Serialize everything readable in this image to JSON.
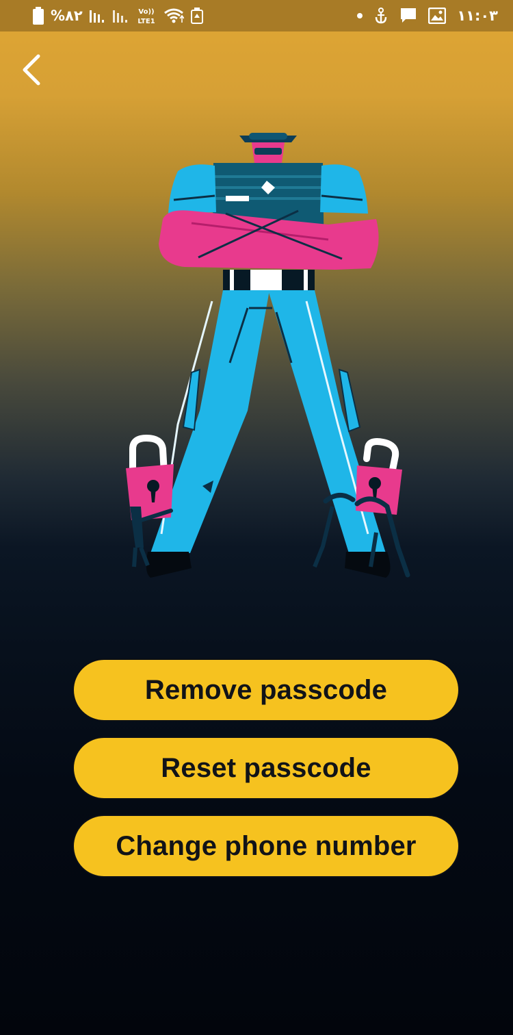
{
  "status_bar": {
    "battery_percent": "%۸۲",
    "network_type": "Vo)) LTE1",
    "time": "۱۱:۰۳",
    "icons": [
      "battery-icon",
      "signal-icon",
      "signal-icon",
      "volte-icon",
      "wifi-icon",
      "data-saver-icon",
      "dot-icon",
      "anchor-icon",
      "message-icon",
      "gallery-icon"
    ]
  },
  "header": {
    "back_icon": "chevron-left-icon"
  },
  "illustration": {
    "subject": "security-guard-with-padlocks"
  },
  "actions": [
    {
      "label": "Remove passcode"
    },
    {
      "label": "Reset passcode"
    },
    {
      "label": "Change phone number"
    }
  ],
  "colors": {
    "button_bg": "#f6c21f",
    "button_text": "#111318",
    "gradient_top": "#e0a633",
    "gradient_bottom": "#02050c",
    "status_bar_bg": "#a87b26"
  }
}
